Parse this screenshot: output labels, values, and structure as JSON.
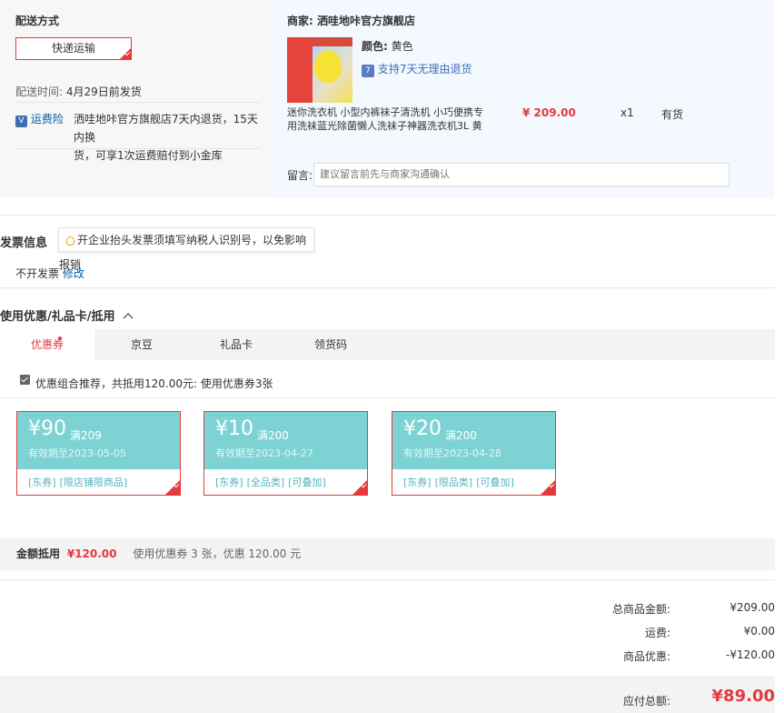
{
  "delivery": {
    "title": "配送方式",
    "shipping_option": "快递运输",
    "ship_time_label": "配送时间:",
    "ship_time_value": "4月29日前发货",
    "insurance_label": "运费险",
    "insurance_text_1": "洒哇地咔官方旗舰店7天内退货，15天内换",
    "insurance_text_2": "货，可享1次运费赔付到小金库"
  },
  "seller": {
    "label": "商家:",
    "name": "洒哇地咔官方旗舰店",
    "product": {
      "color_label": "颜色:",
      "color_value": "黄色",
      "return_policy": "支持7天无理由退货",
      "name_line1": "迷你洗衣机 小型内裤袜子清洗机 小巧便携专",
      "name_line2": "用洗袜蓝光除菌懒人洗袜子神器洗衣机3L 黄",
      "price": "¥ 209.00",
      "quantity": "x1",
      "stock": "有货"
    },
    "message_label": "留言:",
    "message_placeholder": "建议留言前先与商家沟通确认"
  },
  "invoice": {
    "title": "发票信息",
    "tip": "开企业抬头发票须填写纳税人识别号，以免影响报销",
    "status": "不开发票",
    "edit_link": "修改"
  },
  "discount": {
    "title": "使用优惠/礼品卡/抵用",
    "tabs": [
      "优惠券",
      "京豆",
      "礼品卡",
      "领货码"
    ],
    "active_tab": "优惠券",
    "recommend_text": "优惠组合推荐，共抵用120.00元: 使用优惠券3张",
    "coupons": [
      {
        "amount": "¥90",
        "condition": "满209",
        "valid": "有效期至2023-05-05",
        "tags": [
          "[东券]",
          "[限店铺限商品]"
        ]
      },
      {
        "amount": "¥10",
        "condition": "满200",
        "valid": "有效期至2023-04-27",
        "tags": [
          "[东券]",
          "[全品类]",
          "[可叠加]"
        ]
      },
      {
        "amount": "¥20",
        "condition": "满200",
        "valid": "有效期至2023-04-28",
        "tags": [
          "[东券]",
          "[限品类]",
          "[可叠加]"
        ]
      }
    ],
    "summary_label": "金额抵用",
    "summary_amount": "¥120.00",
    "summary_detail": "使用优惠券 3 张，优惠 120.00 元"
  },
  "totals": {
    "goods_label": "总商品金额:",
    "goods_value": "¥209.00",
    "shipping_label": "运费:",
    "shipping_value": "¥0.00",
    "discount_label": "商品优惠:",
    "discount_value": "-¥120.00",
    "pay_label": "应付总额:",
    "pay_value": "¥89.00"
  },
  "colors": {
    "accent_red": "#e4393c",
    "coupon_teal": "#7dd3d3",
    "link_blue": "#005ea7"
  }
}
